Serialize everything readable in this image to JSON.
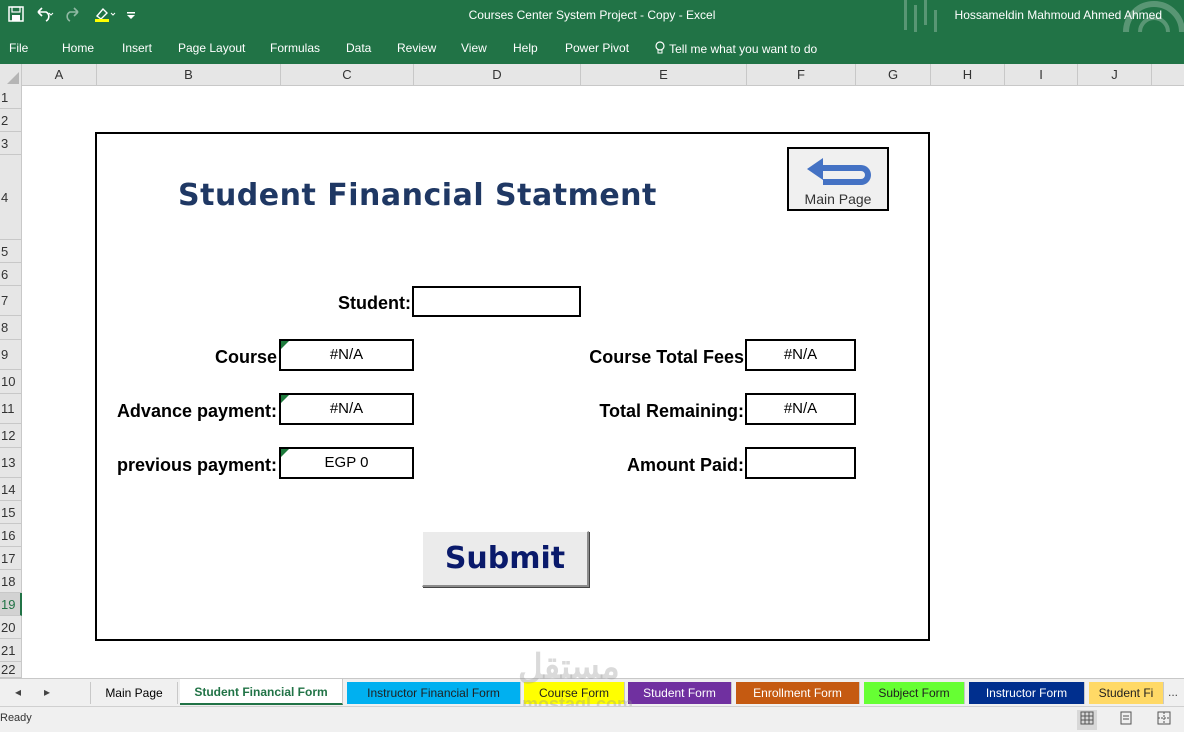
{
  "window": {
    "title": "Courses Center System Project - Copy  -  Excel",
    "user": "Hossameldin Mahmoud Ahmed Ahmed"
  },
  "ribbon": {
    "tabs": [
      "File",
      "Home",
      "Insert",
      "Page Layout",
      "Formulas",
      "Data",
      "Review",
      "View",
      "Help",
      "Power Pivot"
    ],
    "tell_me": "Tell me what you want to do"
  },
  "grid": {
    "columns": [
      "A",
      "B",
      "C",
      "D",
      "E",
      "F",
      "G",
      "H",
      "I",
      "J"
    ],
    "rows": [
      "1",
      "2",
      "3",
      "4",
      "5",
      "6",
      "7",
      "8",
      "9",
      "10",
      "11",
      "12",
      "13",
      "14",
      "15",
      "16",
      "17",
      "18",
      "19",
      "20",
      "21",
      "22"
    ],
    "selected_row": "19"
  },
  "form": {
    "title": "Student Financial Statment",
    "main_page_button": "Main Page",
    "student_label": "Student:",
    "student_value": "",
    "course_label": "Course",
    "course_value": "#N/A",
    "advance_label": "Advance payment:",
    "advance_value": "#N/A",
    "previous_label": "previous payment:",
    "previous_value": "EGP 0",
    "total_fees_label": "Course Total Fees",
    "total_fees_value": "#N/A",
    "remaining_label": "Total Remaining:",
    "remaining_value": "#N/A",
    "amount_paid_label": "Amount Paid:",
    "amount_paid_value": "",
    "submit_label": "Submit"
  },
  "sheet_tabs": [
    {
      "label": "Main Page",
      "color": "#f0f0f0",
      "text_color": "#444444"
    },
    {
      "label": "Student Financial Form",
      "color": "#ffffff",
      "text_color": "#217346"
    },
    {
      "label": "Instructor Financial Form",
      "color": "#00b0f0",
      "text_color": "#1f1f1f"
    },
    {
      "label": "Course Form",
      "color": "#ffff00",
      "text_color": "#1f1f1f"
    },
    {
      "label": "Student Form",
      "color": "#7030a0",
      "text_color": "#ffffff"
    },
    {
      "label": "Enrollment Form",
      "color": "#c55a11",
      "text_color": "#ffffff"
    },
    {
      "label": "Subject Form",
      "color": "#66ff33",
      "text_color": "#1f1f1f"
    },
    {
      "label": "Instructor Form",
      "color": "#002f8e",
      "text_color": "#ffffff"
    },
    {
      "label": "Student Fi",
      "color": "#ffd966",
      "text_color": "#1f1f1f"
    }
  ],
  "status": {
    "text": "Ready",
    "more_tabs": "..."
  },
  "watermark": {
    "text": "مستقل",
    "sub": "mostaql.com"
  },
  "icons": {
    "save": "save-icon",
    "undo": "undo-icon",
    "redo": "redo-icon",
    "highlight": "highlight-icon",
    "lightbulb": "lightbulb-icon",
    "back_arrow": "back-arrow-icon"
  },
  "colors": {
    "excel_green": "#217346",
    "title_navy": "#1f3864",
    "submit_text": "#0a1a6b",
    "back_arrow": "#4472c4"
  }
}
